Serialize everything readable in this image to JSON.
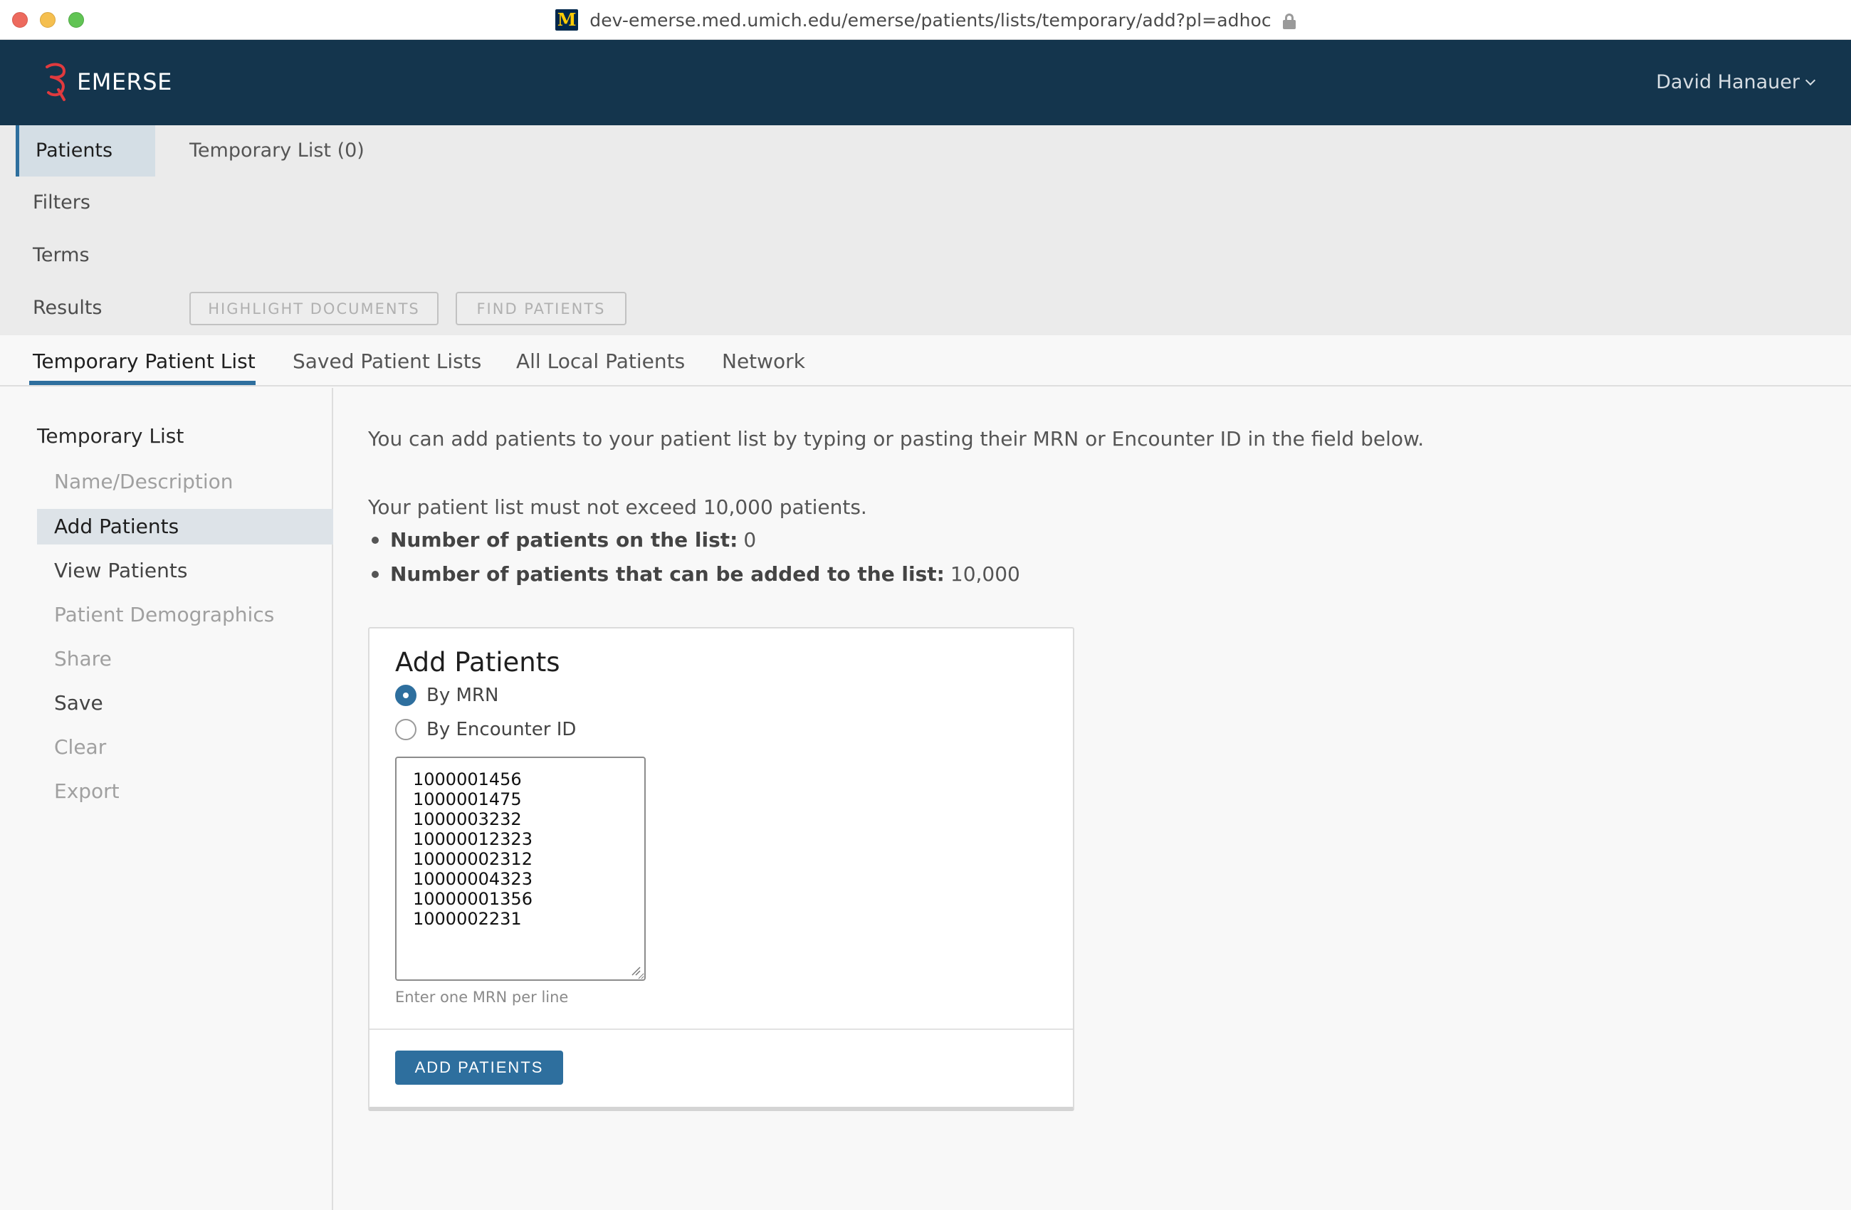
{
  "browser": {
    "url": "dev-emerse.med.umich.edu/emerse/patients/lists/temporary/add?pl=adhoc",
    "favicon": "M"
  },
  "app": {
    "name": "EMERSE",
    "user": "David Hanauer",
    "brand_color": "#14354d",
    "accent_color": "#2e6f9e"
  },
  "query_nav": {
    "items": [
      {
        "label": "Patients",
        "active": true
      },
      {
        "label": "Filters"
      },
      {
        "label": "Terms"
      },
      {
        "label": "Results"
      }
    ],
    "title": "Temporary List (0)",
    "highlight_label": "HIGHLIGHT DOCUMENTS",
    "find_label": "FIND PATIENTS"
  },
  "tabs": [
    {
      "label": "Temporary Patient List",
      "active": true
    },
    {
      "label": "Saved Patient Lists"
    },
    {
      "label": "All Local Patients"
    },
    {
      "label": "Network"
    }
  ],
  "sidebar": {
    "heading": "Temporary List",
    "items": [
      {
        "label": "Name/Description"
      },
      {
        "label": "Add Patients"
      },
      {
        "label": "View Patients"
      },
      {
        "label": "Patient Demographics"
      },
      {
        "label": "Share"
      },
      {
        "label": "Save"
      },
      {
        "label": "Clear"
      },
      {
        "label": "Export"
      }
    ]
  },
  "main": {
    "intro": "You can add patients to your patient list by typing or pasting their MRN or Encounter ID in the field below.",
    "limit": "Your patient list must not exceed 10,000 patients.",
    "stats": [
      {
        "label": "Number of patients on the list:",
        "value": "0"
      },
      {
        "label": "Number of patients that can be added to the list:",
        "value": "10,000"
      }
    ],
    "card": {
      "title": "Add Patients",
      "options": [
        {
          "label": "By MRN",
          "selected": true
        },
        {
          "label": "By Encounter ID",
          "selected": false
        }
      ],
      "mrn_value": "1000001456\n1000001475\n1000003232\n10000012323\n10000002312\n10000004323\n10000001356\n1000002231",
      "hint": "Enter one MRN per line",
      "submit_label": "ADD PATIENTS"
    }
  }
}
